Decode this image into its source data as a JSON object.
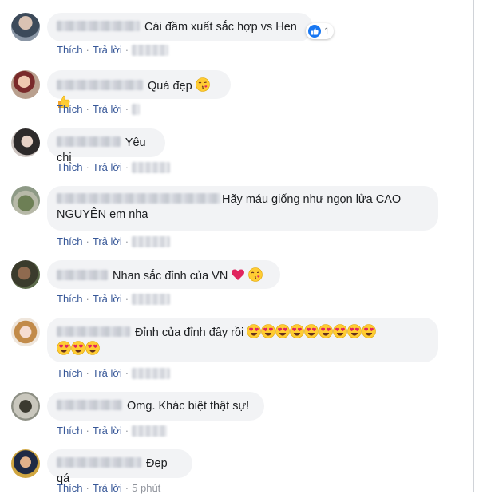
{
  "comments": [
    {
      "text": "Cái đầm xuất sắc hợp vs Hen",
      "reactions": {
        "count": "1",
        "icon": "like-icon"
      },
      "actions": {
        "like": "Thích",
        "reply": "Trả lời"
      }
    },
    {
      "text": "Quá đẹp",
      "emojis": [
        "kiss-face-emoji",
        "thumbs-up-emoji"
      ],
      "actions": {
        "like": "Thích",
        "reply": "Trả lời"
      }
    },
    {
      "text": "Yêu chị",
      "actions": {
        "like": "Thích",
        "reply": "Trả lời"
      }
    },
    {
      "text_line1": "Hãy máu giống như ngọn lửa CAO",
      "text_line2": "NGUYÊN em nha",
      "actions": {
        "like": "Thích",
        "reply": "Trả lời"
      }
    },
    {
      "text": "Nhan sắc đỉnh của VN",
      "emojis": [
        "red-heart-emoji",
        "kiss-face-emoji"
      ],
      "actions": {
        "like": "Thích",
        "reply": "Trả lời"
      }
    },
    {
      "text": "Đỉnh của đỉnh đây rồi",
      "emojis": [
        "heart-eyes-emoji x12"
      ],
      "actions": {
        "like": "Thích",
        "reply": "Trả lời"
      }
    },
    {
      "text": "Omg. Khác biệt thật sự!",
      "actions": {
        "like": "Thích",
        "reply": "Trả lời"
      }
    },
    {
      "text": "Đẹp qá",
      "actions": {
        "like": "Thích",
        "reply": "Trả lời",
        "time": "5 phút"
      }
    }
  ],
  "colors": {
    "link": "#385898",
    "bubble": "#f2f3f5",
    "meta": "#90949c",
    "like_blue": "#1877f2"
  }
}
